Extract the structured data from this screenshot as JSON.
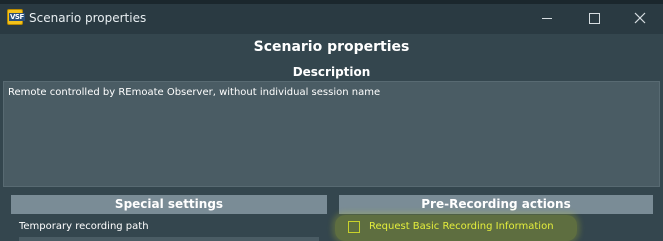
{
  "window": {
    "title": "Scenario properties",
    "app_icon_text": "VSF"
  },
  "main": {
    "title": "Scenario properties",
    "description_heading": "Description",
    "description_text": "Remote controlled by REmoate Observer, without individual session name"
  },
  "special_settings": {
    "heading": "Special settings",
    "temp_path_label": "Temporary recording path",
    "temp_path_value": ""
  },
  "pre_recording": {
    "heading": "Pre-Recording actions",
    "request_basic_info_label": "Request Basic Recording Information",
    "request_basic_info_checked": false
  },
  "colors": {
    "background": "#34464e",
    "section_header": "#7a8c96",
    "highlight": "#cdd61e",
    "checkbox_label": "#e4ee3c"
  }
}
